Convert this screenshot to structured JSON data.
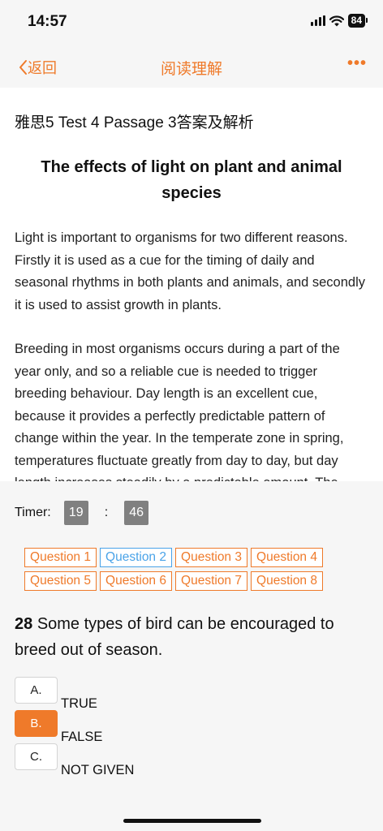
{
  "status_bar": {
    "time": "14:57",
    "battery": "84"
  },
  "nav": {
    "back_label": "返回",
    "title": "阅读理解",
    "more_label": "•••"
  },
  "article": {
    "heading": "雅思5 Test 4 Passage 3答案及解析",
    "title": "The effects of light on plant and animal species",
    "paragraphs": [
      "Light is important to organisms for two different reasons. Firstly it is used as a cue for the timing of daily and seasonal rhythms in both plants and animals, and secondly it is used to assist growth in plants.",
      "Breeding in most organisms occurs during a part of the year only, and so a reliable cue is needed to trigger breeding behaviour. Day length is an excellent cue, because it provides a perfectly predictable pattern of change within the year. In the temperate zone in spring, temperatures fluctuate greatly from day to day, but day length increases steadily by a predictable amount. The"
    ]
  },
  "timer": {
    "label": "Timer:",
    "minutes": "19",
    "separator": ":",
    "seconds": "46"
  },
  "question_tabs": [
    "Question 1",
    "Question 2",
    "Question 3",
    "Question 4",
    "Question 5",
    "Question 6",
    "Question 7",
    "Question 8"
  ],
  "active_tab_index": 1,
  "question": {
    "number": "28",
    "text": "Some types of bird can be encouraged to breed out of season."
  },
  "options": [
    {
      "letter": "A.",
      "text": "TRUE"
    },
    {
      "letter": "B.",
      "text": "FALSE"
    },
    {
      "letter": "C.",
      "text": "NOT GIVEN"
    }
  ],
  "selected_option_index": 1,
  "colors": {
    "accent": "#ef7a2a",
    "active_tab": "#4aa3e8",
    "timer_box": "#808080"
  }
}
